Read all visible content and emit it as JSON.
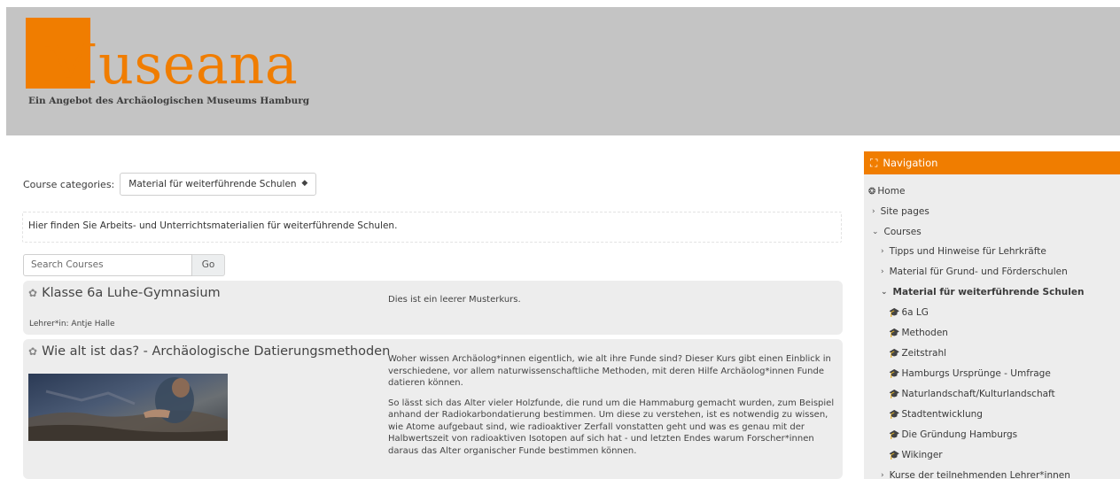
{
  "header": {
    "logo_text": "Museana",
    "logo_subtitle": "Ein Angebot des Archäologischen Museums Hamburg",
    "brand_color": "#f07d00"
  },
  "main": {
    "category_label": "Course categories:",
    "category_selected": "Material für weiterführende Schulen",
    "description": "Hier finden Sie Arbeits- und Unterrichtsmaterialien für weiterführende Schulen.",
    "search_placeholder": "Search Courses",
    "go_label": "Go",
    "courses": [
      {
        "title": "Klasse 6a Luhe-Gymnasium",
        "teacher": "Lehrer*in: Antje Halle",
        "summary": [
          "Dies ist ein leerer Musterkurs."
        ]
      },
      {
        "title": "Wie alt ist das? - Archäologische Datierungsmethoden",
        "summary": [
          "Woher wissen Archäolog*innen eigentlich, wie alt ihre Funde sind? Dieser Kurs gibt einen Einblick in verschiedene, vor allem naturwissenschaftliche Methoden, mit deren Hilfe Archäolog*innen Funde datieren können.",
          "So lässt sich das Alter vieler Holzfunde, die rund um die Hammaburg gemacht wurden, zum Beispiel anhand der Radiokarbondatierung bestimmen. Um diese zu verstehen, ist es notwendig zu wissen, wie Atome aufgebaut sind, wie radioaktiver Zerfall vonstatten geht und was es genau mit der Halbwertszeit von radioaktiven Isotopen auf sich hat - und letzten Endes warum Forscher*innen daraus das Alter organischer Funde bestimmen können."
        ]
      }
    ]
  },
  "sidebar": {
    "title": "Navigation",
    "items": [
      {
        "label": "Home",
        "icon": "dashboard-icon"
      },
      {
        "label": "Site pages",
        "icon": "chevron-right-icon"
      },
      {
        "label": "Courses",
        "icon": "chevron-down-icon"
      },
      {
        "label": "Tipps und Hinweise für Lehrkräfte",
        "icon": "chevron-right-icon"
      },
      {
        "label": "Material für Grund- und Förderschulen",
        "icon": "chevron-right-icon"
      },
      {
        "label": "Material für weiterführende Schulen",
        "icon": "chevron-down-icon"
      },
      {
        "label": "6a LG",
        "icon": "graduation-cap-icon"
      },
      {
        "label": "Methoden",
        "icon": "graduation-cap-icon"
      },
      {
        "label": "Zeitstrahl",
        "icon": "graduation-cap-icon"
      },
      {
        "label": "Hamburgs Ursprünge - Umfrage",
        "icon": "graduation-cap-icon"
      },
      {
        "label": "Naturlandschaft/Kulturlandschaft",
        "icon": "graduation-cap-icon"
      },
      {
        "label": "Stadtentwicklung",
        "icon": "graduation-cap-icon"
      },
      {
        "label": "Die Gründung Hamburgs",
        "icon": "graduation-cap-icon"
      },
      {
        "label": "Wikinger",
        "icon": "graduation-cap-icon"
      },
      {
        "label": "Kurse der teilnehmenden Lehrer*innen",
        "icon": "chevron-right-icon"
      }
    ]
  }
}
